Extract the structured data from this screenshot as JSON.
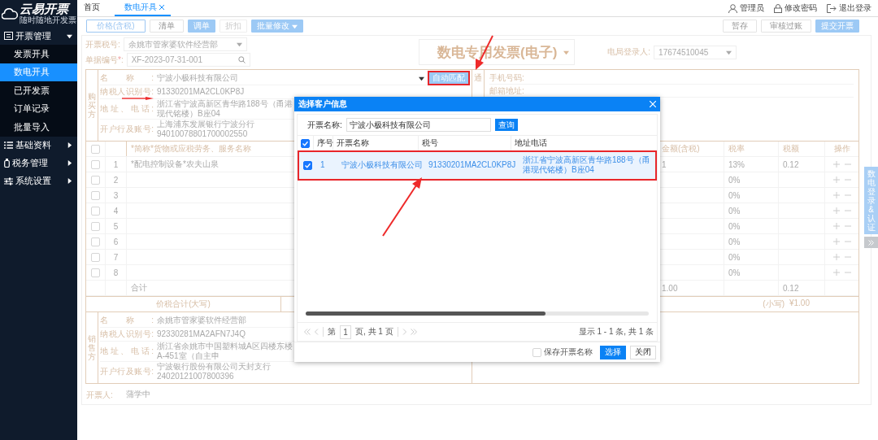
{
  "logo": {
    "title": "云易开票",
    "subtitle": "随时随地开发票"
  },
  "sidebar": {
    "groups": [
      {
        "label": "开票管理",
        "expanded": true,
        "children": [
          {
            "label": "发票开具",
            "selected": false
          },
          {
            "label": "数电开具",
            "selected": true
          },
          {
            "label": "已开发票",
            "selected": false
          },
          {
            "label": "订单记录",
            "selected": false
          },
          {
            "label": "批量导入",
            "selected": false
          }
        ]
      },
      {
        "label": "基础资料",
        "expanded": false
      },
      {
        "label": "税务管理",
        "expanded": false
      },
      {
        "label": "系统设置",
        "expanded": false
      }
    ]
  },
  "tabs": [
    {
      "label": "首页",
      "selected": false,
      "closable": false
    },
    {
      "label": "数电开具",
      "selected": true,
      "closable": true
    }
  ],
  "user_menu": [
    {
      "label": "管理员"
    },
    {
      "label": "修改密码"
    },
    {
      "label": "退出登录"
    }
  ],
  "toolbar": {
    "left": [
      {
        "label": "价格(含税)",
        "kind": "outline"
      },
      {
        "label": "清单",
        "kind": "plain"
      },
      {
        "label": "调单",
        "kind": "primary"
      },
      {
        "label": "折扣",
        "kind": "disabled"
      },
      {
        "label": "批量修改",
        "kind": "dropdown"
      }
    ],
    "right": [
      {
        "label": "暂存",
        "kind": "plain"
      },
      {
        "label": "审核过账",
        "kind": "plain"
      },
      {
        "label": "提交开票",
        "kind": "primary"
      }
    ]
  },
  "header": {
    "tax_no_label": "开票税号:",
    "tax_no": "余姚市管家婆软件经营部",
    "doc_no_label": "单据编号",
    "doc_no_mark": "*",
    "doc_no_colon": ":",
    "doc_no": "XF-2023-07-31-001",
    "invoice_type": "数电专用发票(电子)",
    "login_label": "电局登录人:",
    "login_user": "17674510045"
  },
  "buyer": {
    "side_label": "购买方",
    "fields": [
      {
        "label": "名称:",
        "value": "宁波小极科技有限公司"
      },
      {
        "label": "纳税人识别号:",
        "value": "91330201MA2CL0KP8J"
      },
      {
        "label": "地址、电话:",
        "value": "浙江省宁波高新区青华路188号（甬港现代铭楼）B座04"
      },
      {
        "label": "开户行及账号:",
        "value": "上海浦东发展银行宁波分行 94010078801700002550"
      }
    ],
    "match_button": {
      "label": "自动匹配",
      "highlighted": true
    },
    "contact_side_label": "通",
    "contact_fields": [
      {
        "label": "手机号码:"
      },
      {
        "label": "邮箱地址:"
      }
    ]
  },
  "items": {
    "all_checked": false,
    "columns": [
      {
        "label": "*简称*货物或应税劳务、服务名称"
      },
      {
        "label": "金额(含税)"
      },
      {
        "label": "税率"
      },
      {
        "label": "税额"
      },
      {
        "label": "操作"
      }
    ],
    "rows": [
      {
        "checked": false,
        "no": "1",
        "name": "*配电控制设备*农夫山泉",
        "amount": "1",
        "rate": "13%",
        "tax": "0.12"
      },
      {
        "checked": false,
        "no": "2",
        "rate": "0%"
      },
      {
        "checked": false,
        "no": "3",
        "rate": "0%"
      },
      {
        "checked": false,
        "no": "4",
        "rate": "0%"
      },
      {
        "checked": false,
        "no": "5",
        "rate": "0%"
      },
      {
        "checked": false,
        "no": "6",
        "rate": "0%"
      },
      {
        "checked": false,
        "no": "7",
        "rate": "0%"
      },
      {
        "checked": false,
        "no": "8",
        "rate": "0%"
      }
    ],
    "total": {
      "label": "合计",
      "amount": "1.00",
      "tax": "0.12"
    }
  },
  "grand_total": {
    "words_label": "价税合计(大写)",
    "figures_label": "(小写)",
    "figures": "¥1.00"
  },
  "seller": {
    "side_label": "销售方",
    "fields": [
      {
        "label": "名称:",
        "value": "余姚市管家婆软件经营部"
      },
      {
        "label": "纳税人识别号:",
        "value": "92330281MA2AFN7J4Q"
      },
      {
        "label": "地址、电话:",
        "value": "浙江省余姚市中国塑料城A区四楼东楼A-451室（自主申"
      },
      {
        "label": "开户行及账号:",
        "value": "宁波银行股份有限公司天封支行 24020121007800396"
      }
    ]
  },
  "footer": {
    "drawer_label": "开票人:",
    "drawer": "蒲学中"
  },
  "side_tab": {
    "label": "数电登录&认证"
  },
  "dialog": {
    "title": "选择客户信息",
    "search_label": "开票名称:",
    "search_value": "宁波小极科技有限公司",
    "search_button": "查询",
    "columns": [
      {
        "label": "序号"
      },
      {
        "label": "开票名称"
      },
      {
        "label": "税号"
      },
      {
        "label": "地址电话"
      }
    ],
    "all_checked": true,
    "rows": [
      {
        "checked": true,
        "selected": true,
        "highlighted": true,
        "no": "1",
        "name": "宁波小极科技有限公司",
        "tax_no": "91330201MA2CL0KP8J",
        "address": "浙江省宁波高新区青华路188号（甬港现代铭楼）B座04"
      }
    ],
    "scroll": {
      "level": 0.7
    },
    "pager": {
      "prefix": "第",
      "page": "1",
      "suffix": "页, 共 1 页",
      "summary": "显示 1 - 1 条, 共 1 条"
    },
    "save_label": "保存开票名称",
    "save_checked": false,
    "buttons": [
      {
        "label": "选择",
        "kind": "primary"
      },
      {
        "label": "关闭",
        "kind": "plain"
      }
    ]
  }
}
